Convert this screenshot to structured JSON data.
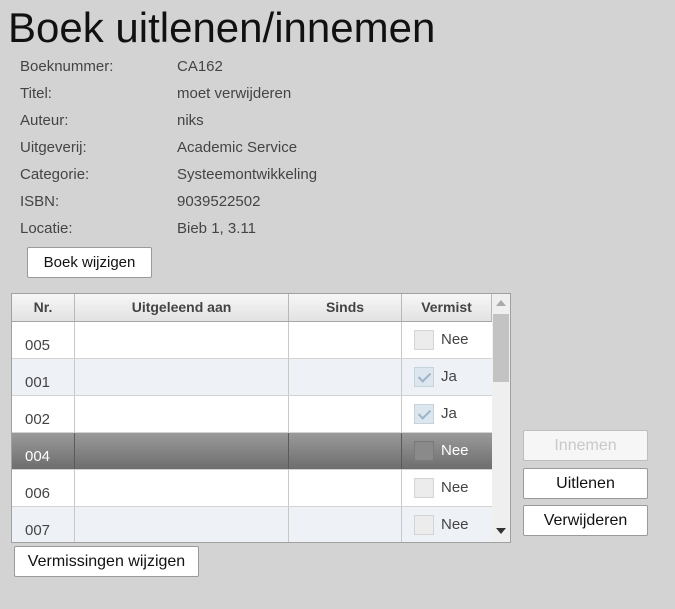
{
  "page": {
    "title": "Boek uitlenen/innemen"
  },
  "book": {
    "fields": [
      {
        "label": "Boeknummer:",
        "value": "CA162"
      },
      {
        "label": "Titel:",
        "value": "moet verwijderen"
      },
      {
        "label": "Auteur:",
        "value": "niks"
      },
      {
        "label": "Uitgeverij:",
        "value": "Academic Service"
      },
      {
        "label": "Categorie:",
        "value": "Systeemontwikkeling"
      },
      {
        "label": "ISBN:",
        "value": "9039522502"
      },
      {
        "label": "Locatie:",
        "value": "Bieb 1, 3.11"
      }
    ],
    "edit_button": "Boek wijzigen"
  },
  "copies_table": {
    "columns": [
      "Nr.",
      "Uitgeleend aan",
      "Sinds",
      "Vermist"
    ],
    "rows": [
      {
        "nr": "005",
        "lent_to": "",
        "since": "",
        "missing": false,
        "missing_label": "Nee",
        "selected": false
      },
      {
        "nr": "001",
        "lent_to": "",
        "since": "",
        "missing": true,
        "missing_label": "Ja",
        "selected": false
      },
      {
        "nr": "002",
        "lent_to": "",
        "since": "",
        "missing": true,
        "missing_label": "Ja",
        "selected": false
      },
      {
        "nr": "004",
        "lent_to": "",
        "since": "",
        "missing": false,
        "missing_label": "Nee",
        "selected": true
      },
      {
        "nr": "006",
        "lent_to": "",
        "since": "",
        "missing": false,
        "missing_label": "Nee",
        "selected": false
      },
      {
        "nr": "007",
        "lent_to": "",
        "since": "",
        "missing": false,
        "missing_label": "Nee",
        "selected": false
      }
    ]
  },
  "actions": {
    "return_button": "Innemen",
    "return_enabled": false,
    "lend_button": "Uitlenen",
    "delete_button": "Verwijderen",
    "missing_button": "Vermissingen wijzigen"
  }
}
